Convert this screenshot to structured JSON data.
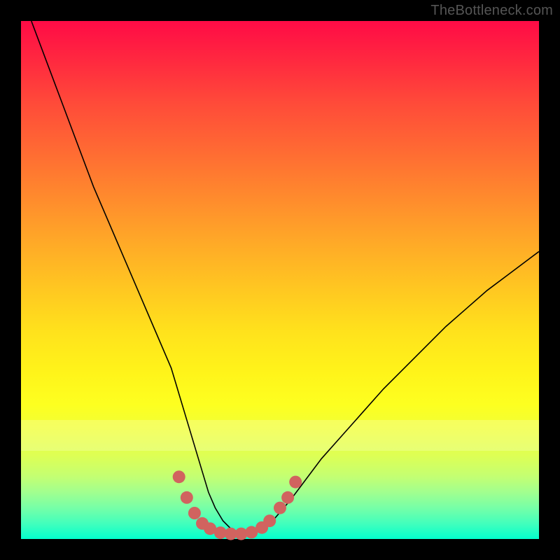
{
  "watermark": {
    "text": "TheBottleneck.com"
  },
  "chart_data": {
    "type": "line",
    "title": "",
    "xlabel": "",
    "ylabel": "",
    "xlim": [
      0,
      100
    ],
    "ylim": [
      0,
      100
    ],
    "series": [
      {
        "name": "bottleneck-curve",
        "x": [
          2,
          5,
          8,
          11,
          14,
          17,
          20,
          23,
          26,
          29,
          30.5,
          32,
          33.5,
          35,
          36.2,
          37.5,
          39,
          40.5,
          42,
          43.5,
          45,
          47,
          49,
          52,
          55,
          58,
          62,
          66,
          70,
          74,
          78,
          82,
          86,
          90,
          94,
          98,
          100
        ],
        "values": [
          100,
          92,
          84,
          76,
          68,
          61,
          54,
          47,
          40,
          33,
          28,
          23,
          18,
          13,
          9,
          6,
          3.5,
          2,
          1.2,
          1,
          1.3,
          2.2,
          4,
          7.5,
          11.5,
          15.5,
          20,
          24.5,
          29,
          33,
          37,
          41,
          44.5,
          48,
          51,
          54,
          55.5
        ]
      }
    ],
    "markers": [
      {
        "x": 30.5,
        "y": 12
      },
      {
        "x": 32,
        "y": 8
      },
      {
        "x": 33.5,
        "y": 5
      },
      {
        "x": 35,
        "y": 3
      },
      {
        "x": 36.5,
        "y": 2
      },
      {
        "x": 38.5,
        "y": 1.2
      },
      {
        "x": 40.5,
        "y": 1
      },
      {
        "x": 42.5,
        "y": 1
      },
      {
        "x": 44.5,
        "y": 1.3
      },
      {
        "x": 46.5,
        "y": 2.2
      },
      {
        "x": 48,
        "y": 3.5
      },
      {
        "x": 50,
        "y": 6
      },
      {
        "x": 51.5,
        "y": 8
      },
      {
        "x": 53,
        "y": 11
      }
    ],
    "gradient_stops": [
      {
        "pos": 0,
        "color": "#ff0b46"
      },
      {
        "pos": 25,
        "color": "#ff6a33"
      },
      {
        "pos": 52,
        "color": "#ffc821"
      },
      {
        "pos": 74,
        "color": "#fdff20"
      },
      {
        "pos": 100,
        "color": "#03ffcd"
      }
    ]
  }
}
